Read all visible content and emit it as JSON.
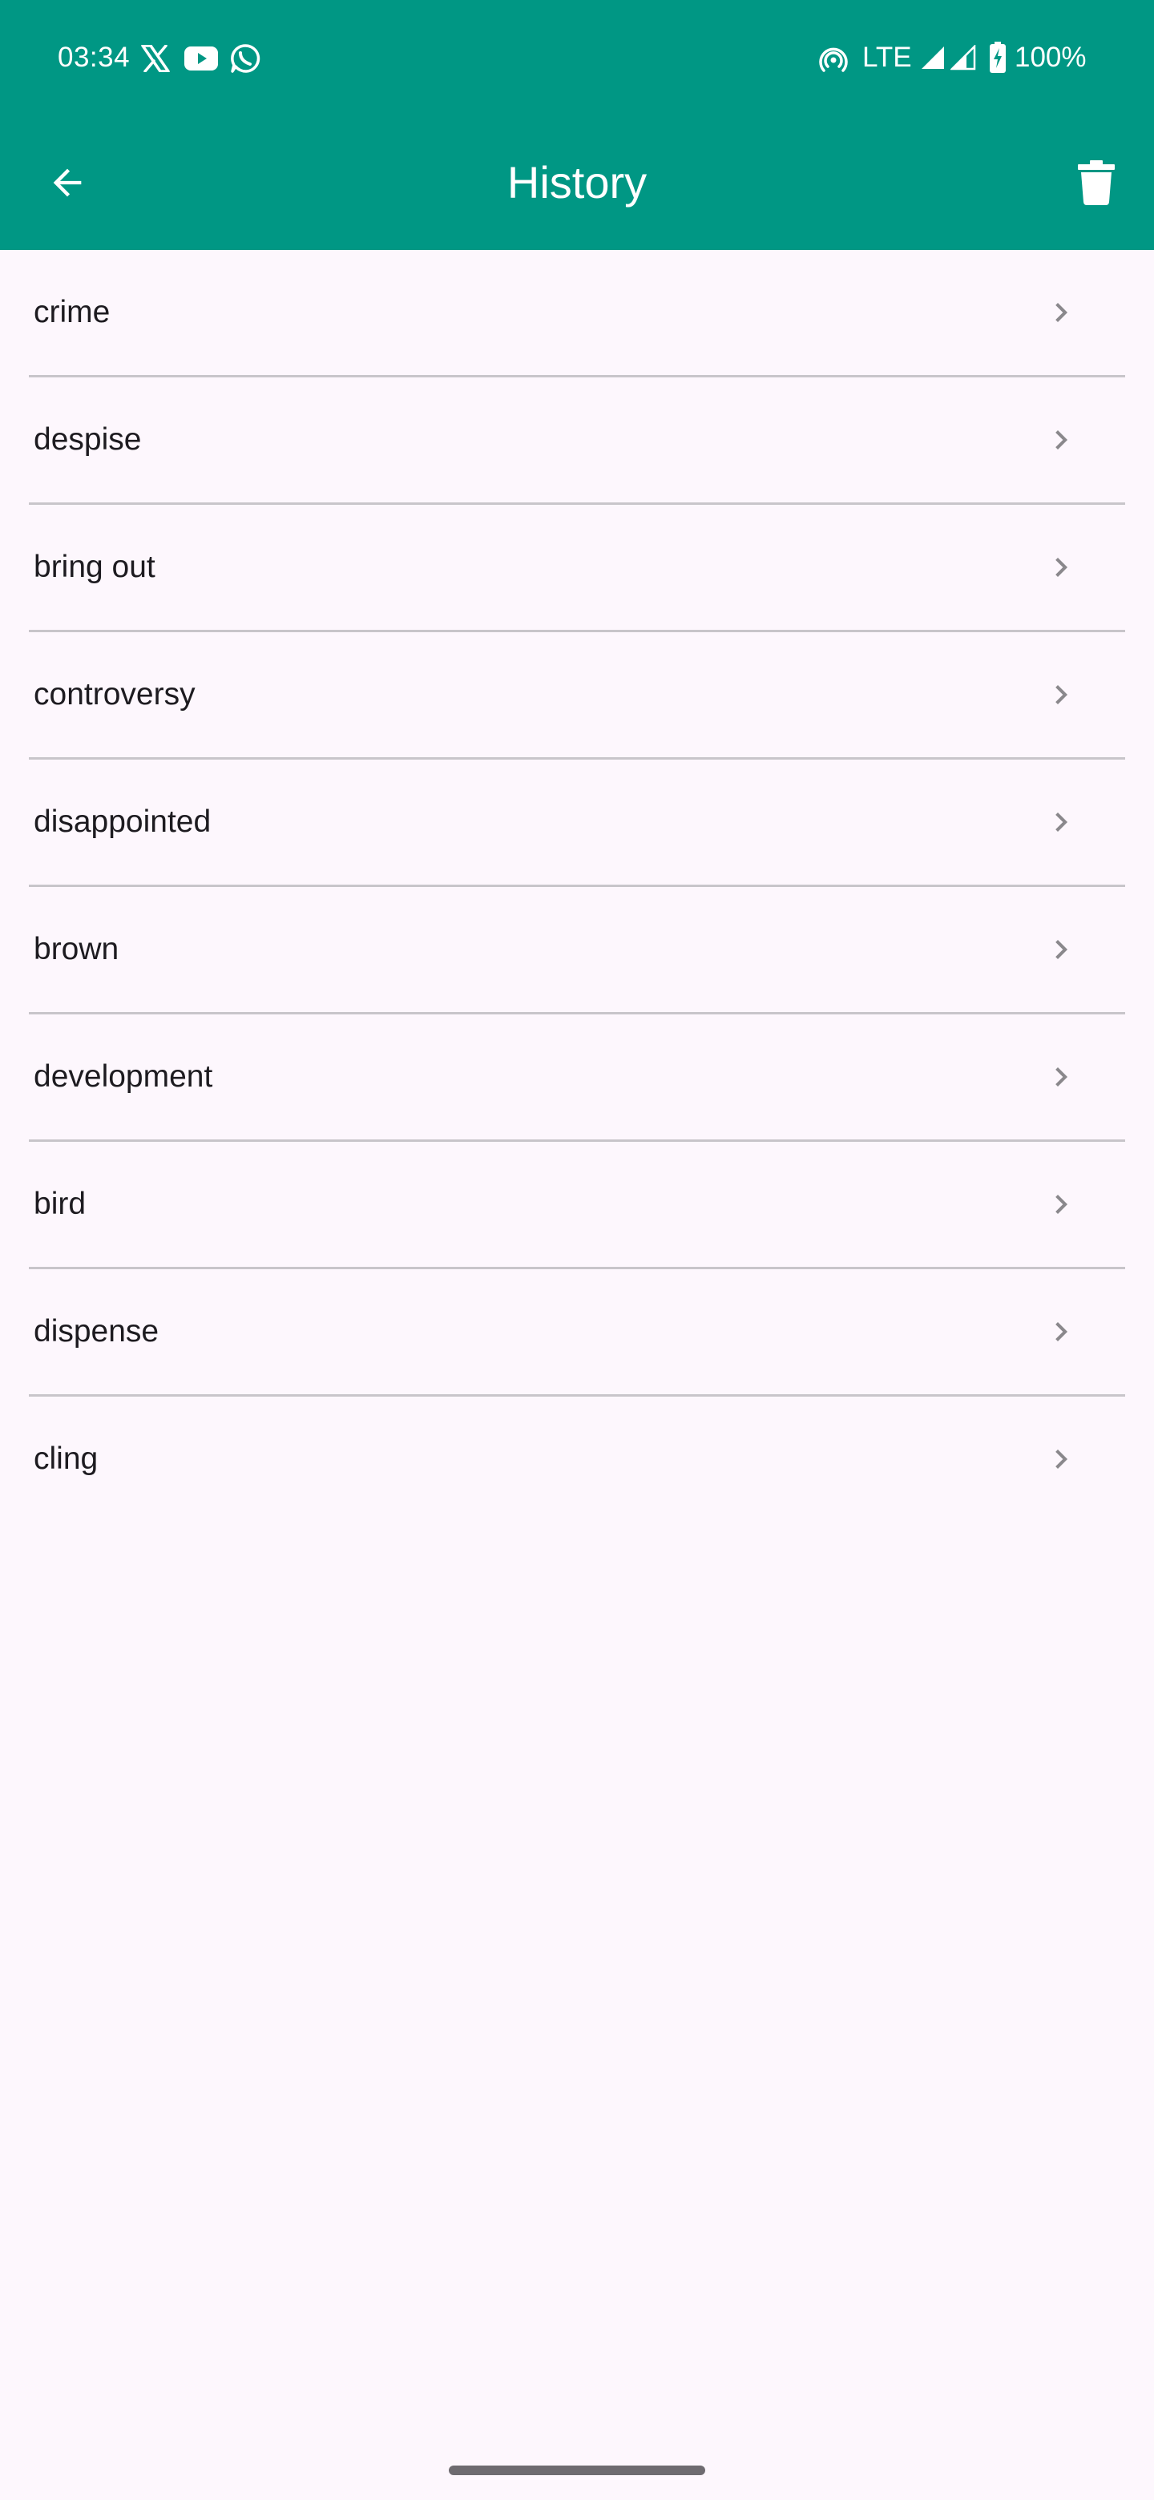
{
  "status_bar": {
    "time": "03:34",
    "network": "LTE",
    "battery": "100%",
    "icons": [
      "x-app-icon",
      "youtube-icon",
      "whatsapp-icon",
      "hotspot-icon",
      "signal-icon",
      "signal-icon-2",
      "battery-charging-icon"
    ]
  },
  "toolbar": {
    "title": "History",
    "back_icon": "arrow-back-icon",
    "delete_icon": "trash-icon"
  },
  "history": {
    "items": [
      {
        "label": "crime"
      },
      {
        "label": "despise"
      },
      {
        "label": "bring out"
      },
      {
        "label": "controversy"
      },
      {
        "label": "disappointed"
      },
      {
        "label": "brown"
      },
      {
        "label": "development"
      },
      {
        "label": "bird"
      },
      {
        "label": "dispense"
      },
      {
        "label": "cling"
      }
    ],
    "item_icon": "chevron-right-icon"
  },
  "colors": {
    "app_bar": "#009784",
    "background": "#fdf7fd",
    "divider": "#c8c5ca",
    "text": "#1d1b20",
    "chevron": "#8a888c"
  }
}
